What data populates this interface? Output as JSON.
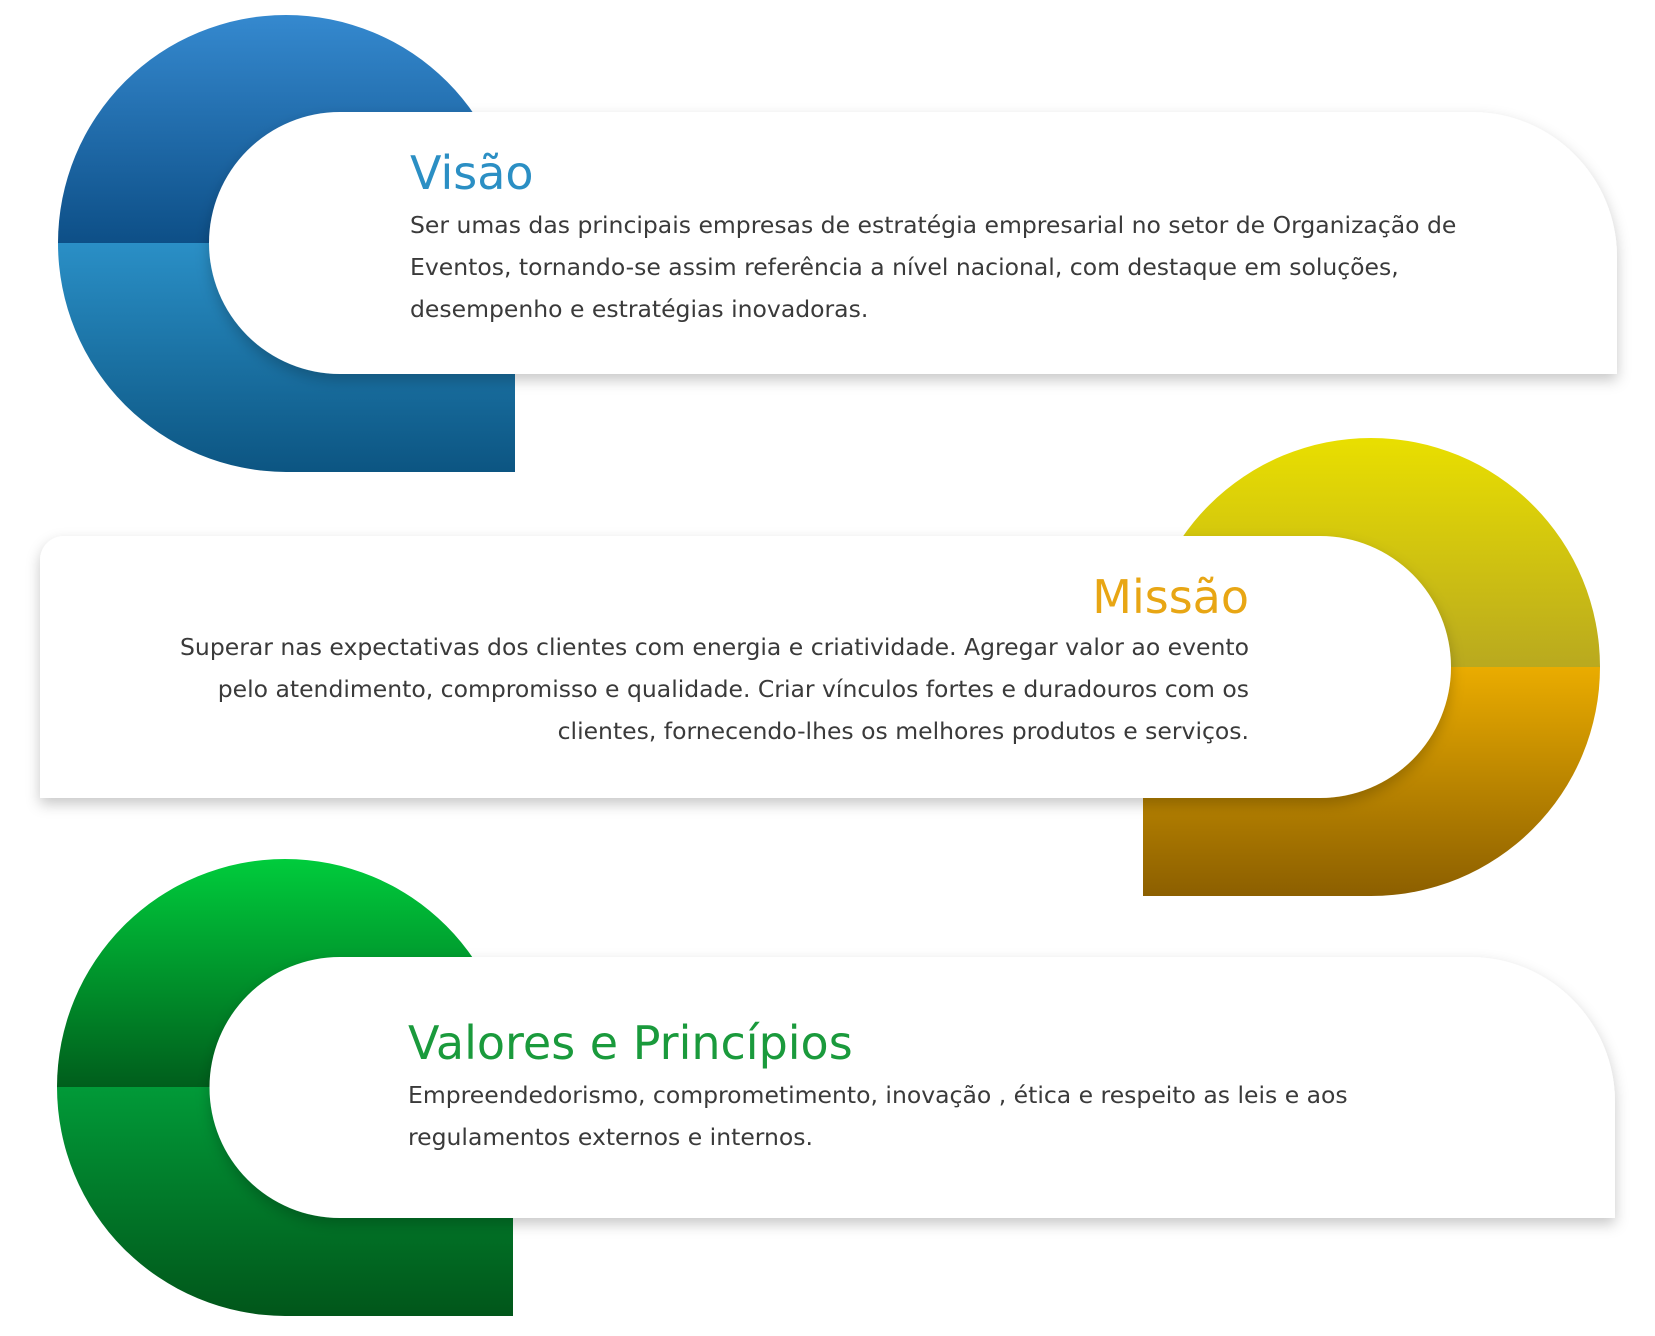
{
  "sections": [
    {
      "title": "Visão",
      "text": "Ser umas das principais empresas de estratégia empresarial no setor de Organização de Eventos, tornando-se assim referência a nível nacional, com destaque em soluções, desempenho e estratégias inovadoras.",
      "title_color": "#2b8fc4",
      "ring_top": [
        "#3589cf",
        "#0d4f87"
      ],
      "ring_bottom": [
        "#2a8fc6",
        "#0c5582"
      ]
    },
    {
      "title": "Missão",
      "text": "Superar nas expectativas dos clientes com energia e criatividade. Agregar valor ao evento pelo atendimento, compromisso e qualidade. Criar vínculos fortes e duradouros com os clientes, fornecendo-lhes os melhores produtos e serviços.",
      "title_color": "#e8a614",
      "ring_top": [
        "#e9df00",
        "#b9a91f"
      ],
      "ring_bottom": [
        "#eaac00",
        "#8c5f00"
      ]
    },
    {
      "title": "Valores e Princípios",
      "text": "Empreendedorismo, comprometimento, inovação , ética e respeito as leis e aos regulamentos externos e internos.",
      "title_color": "#1a9a3c",
      "ring_top": [
        "#00cc3c",
        "#005e1c"
      ],
      "ring_bottom": [
        "#019a38",
        "#01561a"
      ]
    }
  ]
}
